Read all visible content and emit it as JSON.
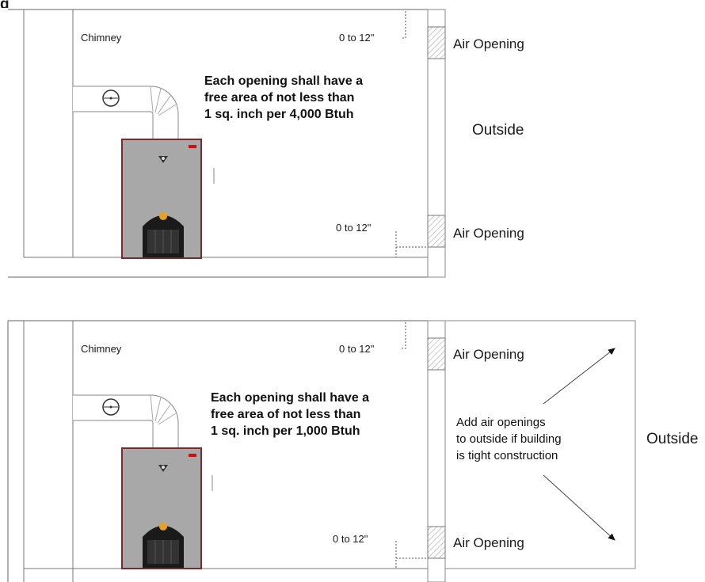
{
  "figure_number": "g",
  "top_diagram": {
    "chimney_label": "Chimney",
    "note": "Each opening shall have a\nfree area of not less than\n1 sq. inch per 4,000 Btuh",
    "upper_clearance": "0 to 12\"",
    "lower_clearance": "0 to 12\"",
    "upper_opening_label": "Air Opening",
    "lower_opening_label": "Air Opening",
    "outside_label": "Outside"
  },
  "bottom_diagram": {
    "chimney_label": "Chimney",
    "note": "Each opening shall have a\nfree area of not less than\n1 sq. inch per 1,000 Btuh",
    "upper_clearance": "0 to 12\"",
    "lower_clearance": "0 to 12\"",
    "upper_opening_label": "Air Opening",
    "lower_opening_label": "Air Opening",
    "tip": "Add air openings\nto outside if building\nis tight construction",
    "outside_label": "Outside"
  },
  "colors": {
    "line": "#555555",
    "furnace_body": "#a8a8a8",
    "furnace_frame": "#7a2a2a",
    "burner": "#1a1a1a",
    "flame": "#e8a020",
    "indicator": "#d01010",
    "hatch": "#999999"
  }
}
